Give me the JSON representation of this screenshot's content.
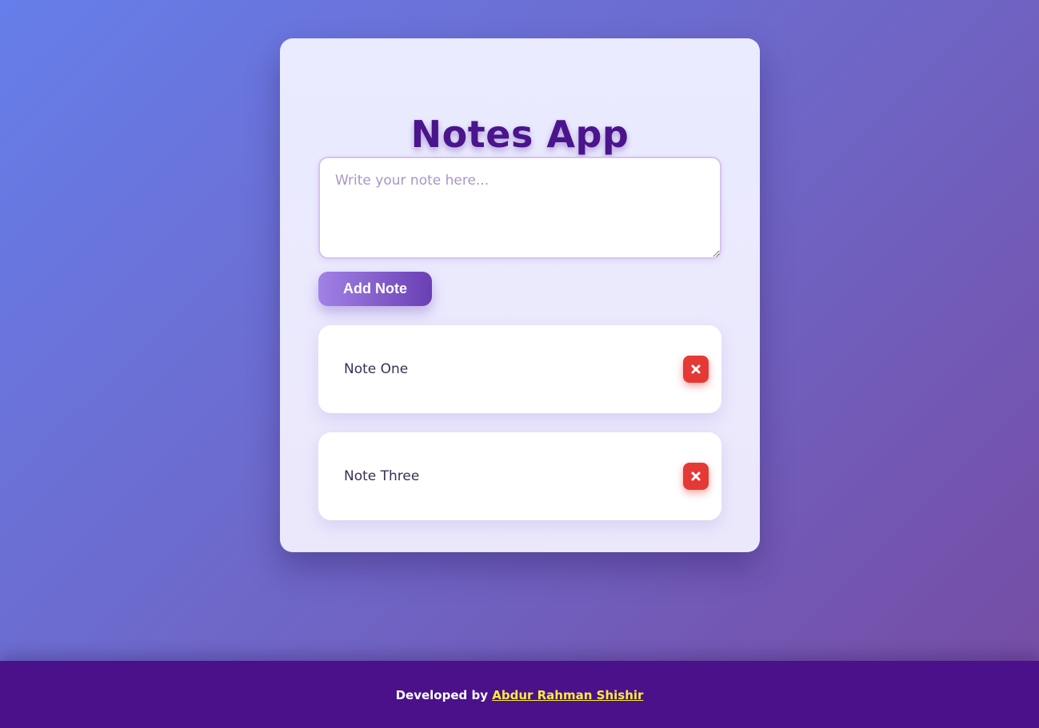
{
  "app": {
    "title": "Notes App"
  },
  "composer": {
    "placeholder": "Write your note here...",
    "value": "",
    "add_label": "Add Note"
  },
  "notes": [
    {
      "text": "Note One",
      "delete_icon": "close-icon"
    },
    {
      "text": "Note Three",
      "delete_icon": "close-icon"
    }
  ],
  "footer": {
    "prefix": "Developed by",
    "author": "Abdur Rahman Shishir"
  },
  "colors": {
    "title": "#4a148c",
    "delete": "#e53935",
    "footer_bg": "#4a118a",
    "footer_link": "#ffeb3b"
  }
}
